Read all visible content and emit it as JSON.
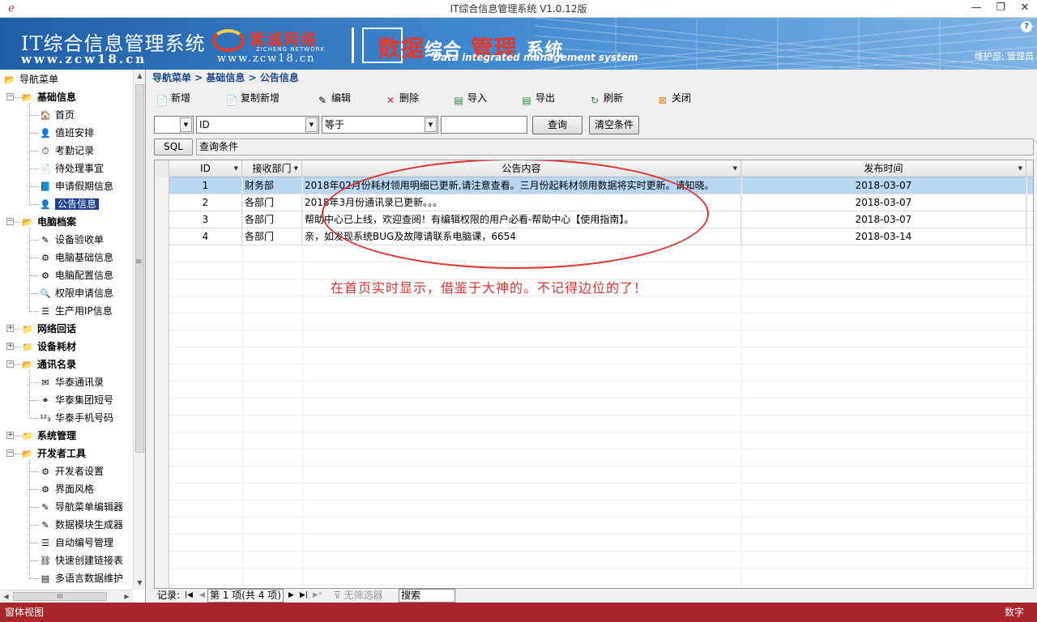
{
  "window": {
    "title": "IT综合信息管理系统 V1.0.12版",
    "minimize": "—",
    "restore": "❐",
    "close": "✕"
  },
  "banner": {
    "system_name": "IT综合信息管理系统",
    "url1": "www.zcw18.cn",
    "brand": "紫诚网络",
    "brand_en": "ZICHENG NETWORK",
    "url2": "www.zcw18.cn",
    "data_title_a": "数据",
    "data_title_b": "综合",
    "data_title_c": "管理",
    "data_title_d": "系统",
    "data_en": "Data integrated management system",
    "help": "?",
    "dept_label": "维护部: 管理员"
  },
  "tree": {
    "root": "导航菜单",
    "groups": [
      {
        "label": "基础信息",
        "expanded": true,
        "items": [
          "首页",
          "值班安排",
          "考勤记录",
          "待处理事宜",
          "申请假期信息",
          "公告信息"
        ]
      },
      {
        "label": "电脑档案",
        "expanded": true,
        "items": [
          "设备验收单",
          "电脑基础信息",
          "电脑配置信息",
          "权限申请信息",
          "生产用IP信息"
        ]
      },
      {
        "label": "网络回话",
        "expanded": false,
        "items": []
      },
      {
        "label": "设备耗材",
        "expanded": false,
        "items": []
      },
      {
        "label": "通讯名录",
        "expanded": true,
        "items": [
          "华泰通讯录",
          "华泰集团短号",
          "华泰手机号码"
        ]
      },
      {
        "label": "系统管理",
        "expanded": false,
        "items": []
      },
      {
        "label": "开发者工具",
        "expanded": true,
        "items": [
          "开发者设置",
          "界面风格",
          "导航菜单编辑器",
          "数据模块生成器",
          "自动编号管理",
          "快速创建链接表",
          "多语言数据维护"
        ]
      }
    ],
    "selected": "公告信息",
    "hscroll_grip": "III",
    "vscroll_grip": "≡"
  },
  "content": {
    "breadcrumb": "导航菜单 > 基础信息 > 公告信息",
    "toolbar": {
      "add": "新增",
      "copy_add": "复制新增",
      "edit": "编辑",
      "delete": "删除",
      "import": "导入",
      "export": "导出",
      "refresh": "刷新",
      "close": "关闭"
    },
    "filter": {
      "field1": "",
      "field2": "ID",
      "operator": "等于",
      "value": "",
      "query": "查询",
      "clear": "清空条件"
    },
    "sql": {
      "button": "SQL",
      "condition": "查询条件"
    },
    "grid": {
      "columns": [
        "ID",
        "接收部门",
        "公告内容",
        "发布时间"
      ],
      "rows": [
        [
          "1",
          "财务部",
          "2018年02月份耗材领用明细已更新,请注意查看。三月份起耗材领用数据将实时更新。请知晓。",
          "2018-03-07"
        ],
        [
          "2",
          "各部门",
          "2018年3月份通讯录已更新。。。",
          "2018-03-07"
        ],
        [
          "3",
          "各部门",
          "帮助中心已上线，欢迎查阅！有编辑权限的用户必看-帮助中心【使用指南】。",
          "2018-03-07"
        ],
        [
          "4",
          "各部门",
          "亲，如发现系统BUG及故障请联系电脑课，6654",
          "2018-03-14"
        ]
      ],
      "selected_row": 0
    },
    "annotation": "在首页实时显示，借鉴于大神的。不记得边位的了！",
    "navigator": {
      "label": "记录:",
      "first": "|◀",
      "prev": "◀",
      "page": "第 1 项(共 4 项)",
      "next": "▶",
      "last": "▶|",
      "new": "▶*",
      "no_filter": "无筛选器",
      "search": "搜索"
    }
  },
  "statusbar": {
    "left": "窗体视图",
    "right": "数字"
  },
  "colors": {
    "banner_dark": "#1f5fa8",
    "accent_red": "#e0302a",
    "statusbar": "#a8262b",
    "selected_row": "#b9d6f2",
    "tree_selected": "#1c3f94"
  }
}
